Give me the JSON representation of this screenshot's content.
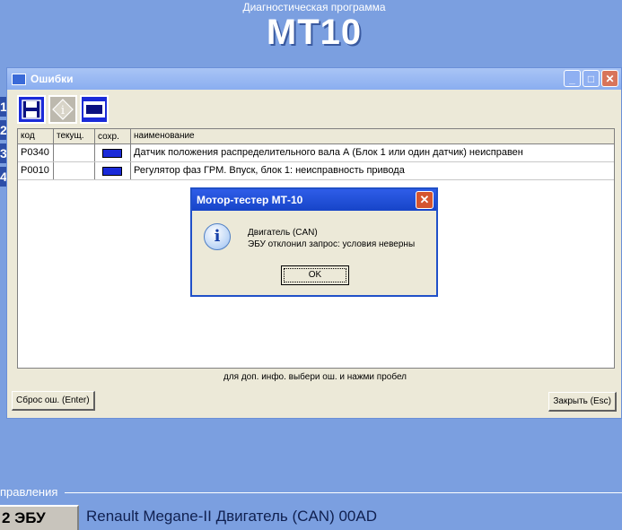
{
  "app": {
    "subtitle": "Диагностическая программа",
    "title": "МТ10",
    "bottom_label": "правления",
    "ecu_button": "2 ЭБУ",
    "car": "Renault Megane-II Двигатель (CAN)  00AD"
  },
  "errors_window": {
    "title": "Ошибки",
    "toolbar": [
      "save-icon",
      "info-icon",
      "film-icon"
    ],
    "columns": [
      "код",
      "текущ.",
      "сохр.",
      "наименование"
    ],
    "rows": [
      {
        "code": "P0340",
        "current": "",
        "saved_flag": true,
        "name": "Датчик положения распределительного вала А (Блок 1 или один датчик) неисправен"
      },
      {
        "code": "P0010",
        "current": "",
        "saved_flag": true,
        "name": "Регулятор фаз ГРМ. Впуск, блок 1: неисправность привода"
      }
    ],
    "hint": "для доп. инфо. выбери ош. и нажми пробел",
    "reset_button": "Сброс ош. (Enter)",
    "close_button": "Закрыть (Esc)"
  },
  "dialog": {
    "title": "Мотор-тестер МТ-10",
    "line1": "Двигатель (CAN)",
    "line2": "ЭБУ отклонил запрос: условия неверны",
    "ok": "OK"
  },
  "colors": {
    "desktop": "#7b9fe0",
    "flag": "#1a2ad8",
    "dialog_title": "#1744c8"
  }
}
